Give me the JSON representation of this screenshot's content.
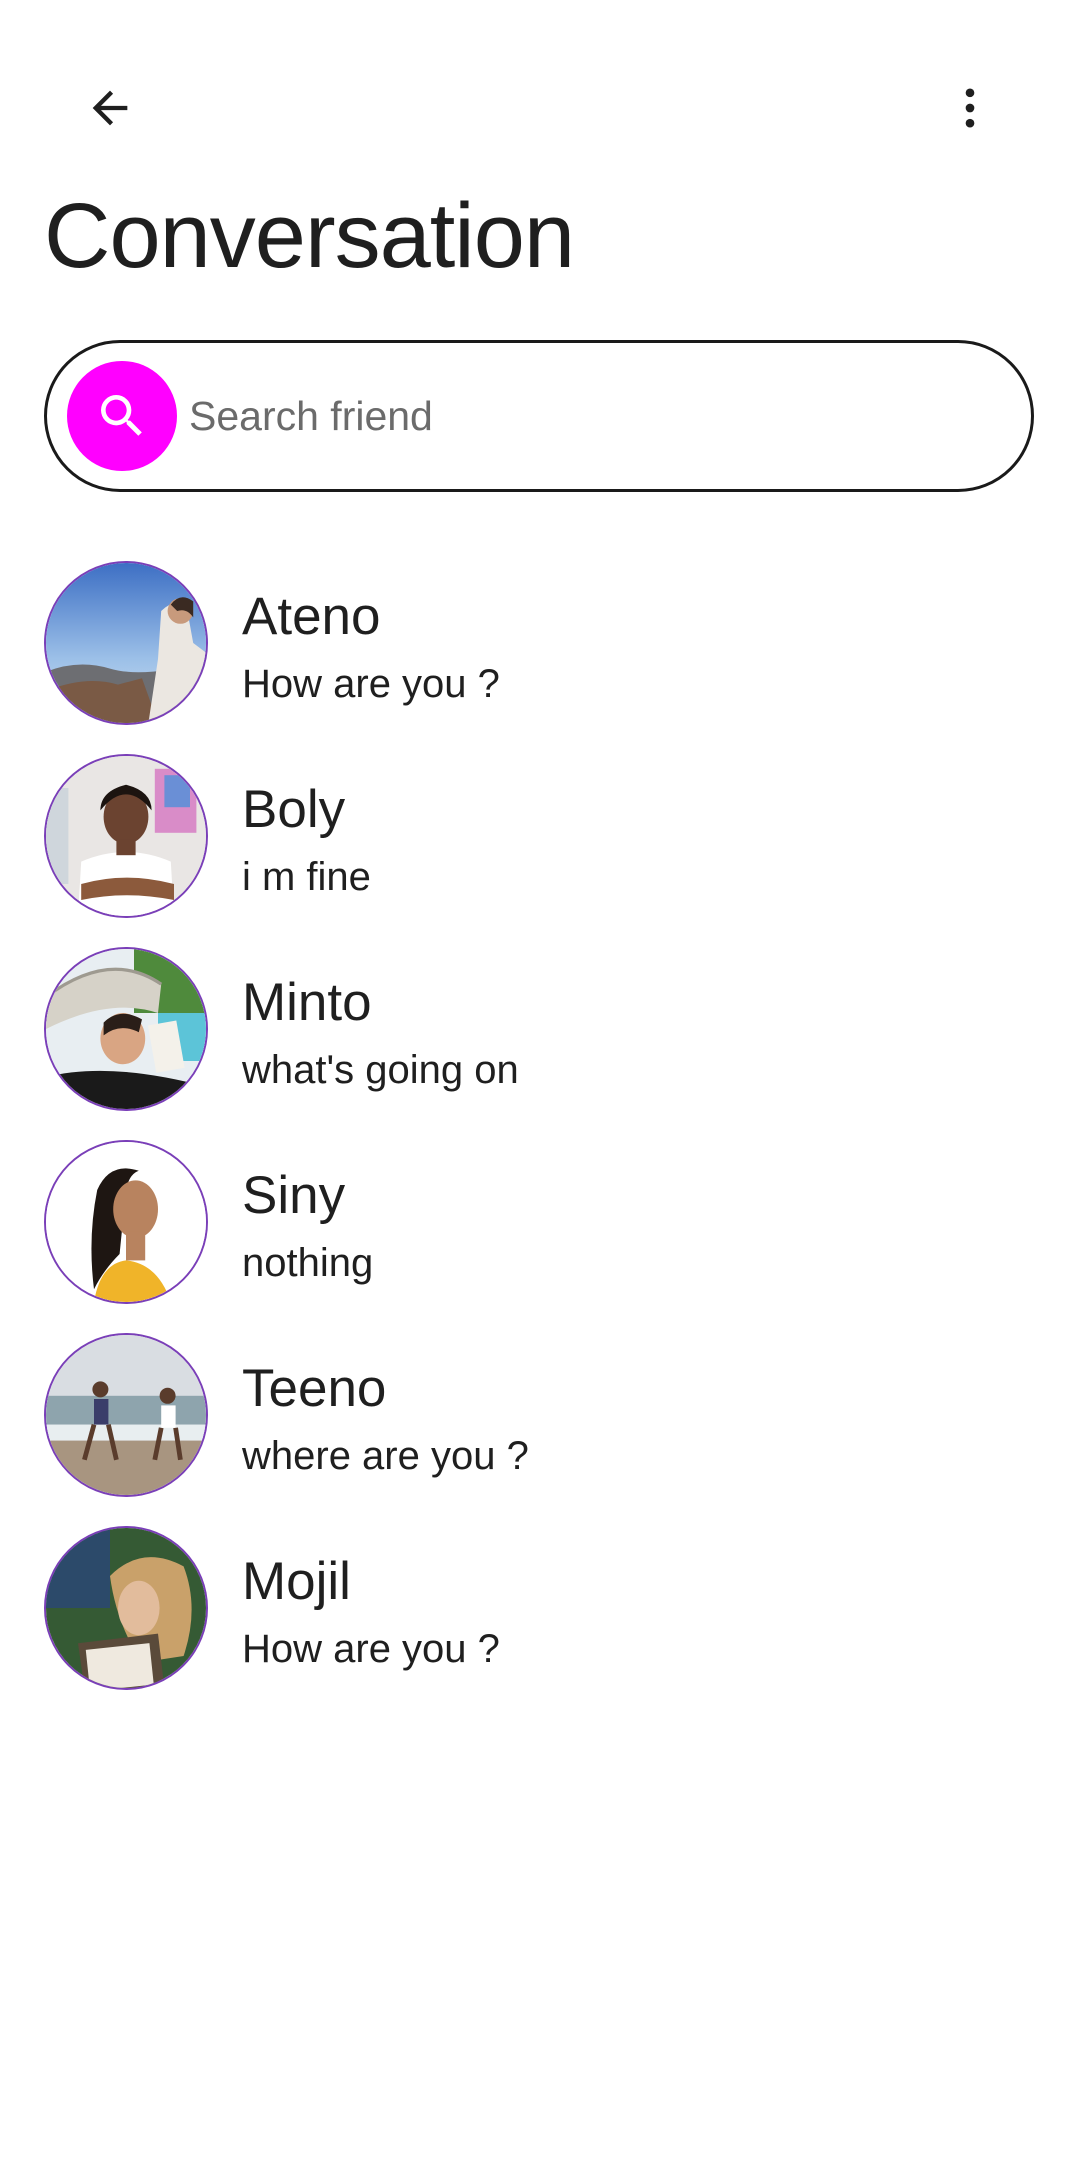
{
  "header": {
    "back_icon": "arrow-back-icon",
    "more_icon": "more-vert-icon",
    "title": "Conversation"
  },
  "search": {
    "icon": "search-icon",
    "icon_bg_color": "#ff00ff",
    "placeholder": "Search friend",
    "value": ""
  },
  "conversations": [
    {
      "name": "Ateno",
      "message": "How are you ?"
    },
    {
      "name": "Boly",
      "message": "i m fine"
    },
    {
      "name": "Minto",
      "message": "what's going on"
    },
    {
      "name": "Siny",
      "message": "nothing"
    },
    {
      "name": "Teeno",
      "message": "where are you ?"
    },
    {
      "name": "Mojil",
      "message": "How are you ?"
    }
  ],
  "colors": {
    "accent": "#ff00ff",
    "avatar_border": "#7a3fb8",
    "text": "#1f1f1f"
  }
}
